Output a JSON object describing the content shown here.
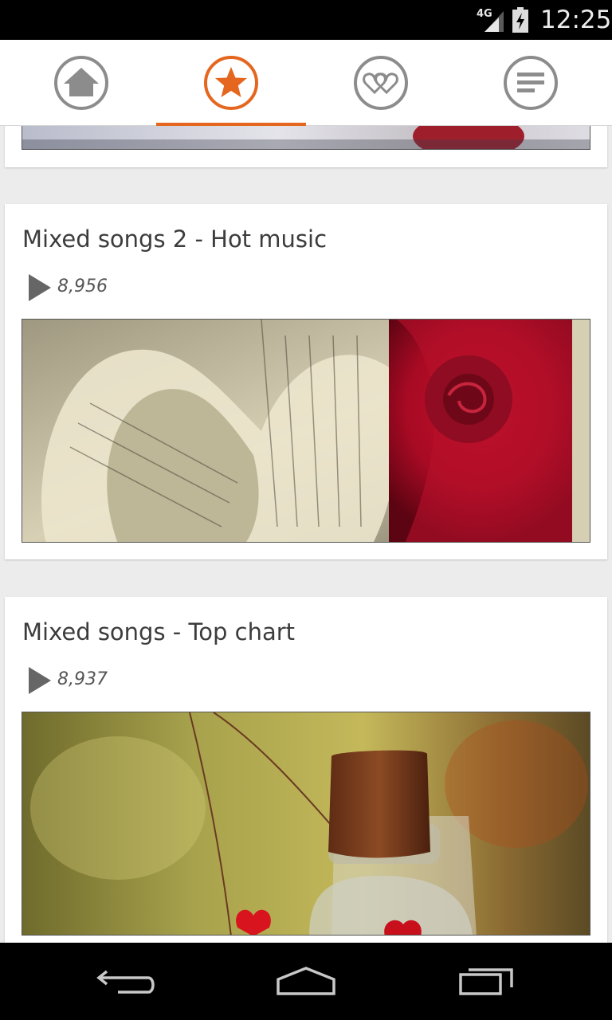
{
  "status_bar": {
    "network": "4G",
    "time": "12:25"
  },
  "tabs": [
    {
      "name": "home",
      "icon": "home-icon",
      "active": false
    },
    {
      "name": "favorites",
      "icon": "star-icon",
      "active": true
    },
    {
      "name": "loves",
      "icon": "hearts-icon",
      "active": false
    },
    {
      "name": "menu",
      "icon": "list-icon",
      "active": false
    }
  ],
  "colors": {
    "accent": "#e5661e",
    "inactive_icon": "#8c8c8c"
  },
  "playlists": [
    {
      "title": "Mixed songs 2 - Hot music",
      "plays": "8,956",
      "image": "sheet-music-heart-and-red-rose"
    },
    {
      "title": "Mixed songs - Top chart",
      "plays": "8,937",
      "image": "corked-glass-bottle-with-red-hearts"
    }
  ],
  "nav": {
    "back": "back-icon",
    "home": "home-outline-icon",
    "recents": "recents-icon"
  }
}
